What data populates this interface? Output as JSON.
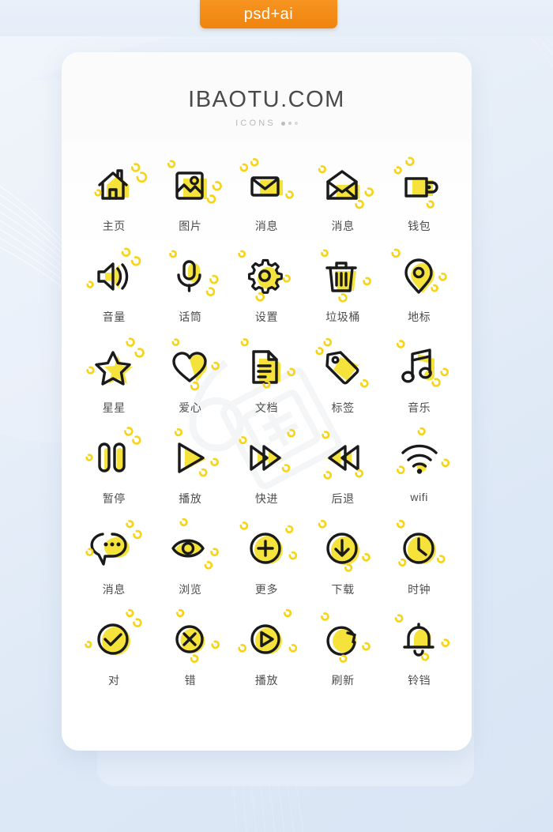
{
  "ribbon": {
    "label": "psd+ai",
    "color": "#f5900f"
  },
  "card": {
    "title": "IBAOTU.COM",
    "subtitle": "ICONS"
  },
  "theme": {
    "icon_fill": "#f5e33c",
    "icon_stroke": "#1a1a1a",
    "spark": "#f7d417",
    "label_color": "#4d4d4d",
    "page_bg": "#e3ecf7",
    "card_bg": "#ffffff",
    "back_card_bg": "#e4ecf8"
  },
  "icons": [
    {
      "label": "主页",
      "name": "home-icon"
    },
    {
      "label": "图片",
      "name": "image-icon"
    },
    {
      "label": "消息",
      "name": "mail-closed-icon"
    },
    {
      "label": "消息",
      "name": "mail-open-icon"
    },
    {
      "label": "钱包",
      "name": "wallet-icon"
    },
    {
      "label": "音量",
      "name": "volume-icon"
    },
    {
      "label": "话筒",
      "name": "microphone-icon"
    },
    {
      "label": "设置",
      "name": "gear-icon"
    },
    {
      "label": "垃圾桶",
      "name": "trash-icon"
    },
    {
      "label": "地标",
      "name": "location-pin-icon"
    },
    {
      "label": "星星",
      "name": "star-icon"
    },
    {
      "label": "爱心",
      "name": "heart-icon"
    },
    {
      "label": "文档",
      "name": "document-icon"
    },
    {
      "label": "标签",
      "name": "tag-icon"
    },
    {
      "label": "音乐",
      "name": "music-note-icon"
    },
    {
      "label": "暂停",
      "name": "pause-icon"
    },
    {
      "label": "播放",
      "name": "play-icon"
    },
    {
      "label": "快进",
      "name": "fast-forward-icon"
    },
    {
      "label": "后退",
      "name": "rewind-icon"
    },
    {
      "label": "wifi",
      "name": "wifi-icon"
    },
    {
      "label": "消息",
      "name": "chat-bubble-icon"
    },
    {
      "label": "浏览",
      "name": "eye-icon"
    },
    {
      "label": "更多",
      "name": "plus-circle-icon"
    },
    {
      "label": "下载",
      "name": "download-circle-icon"
    },
    {
      "label": "时钟",
      "name": "clock-icon"
    },
    {
      "label": "对",
      "name": "check-circle-icon"
    },
    {
      "label": "错",
      "name": "close-circle-icon"
    },
    {
      "label": "播放",
      "name": "play-circle-icon"
    },
    {
      "label": "刷新",
      "name": "refresh-icon"
    },
    {
      "label": "铃铛",
      "name": "bell-icon"
    }
  ]
}
